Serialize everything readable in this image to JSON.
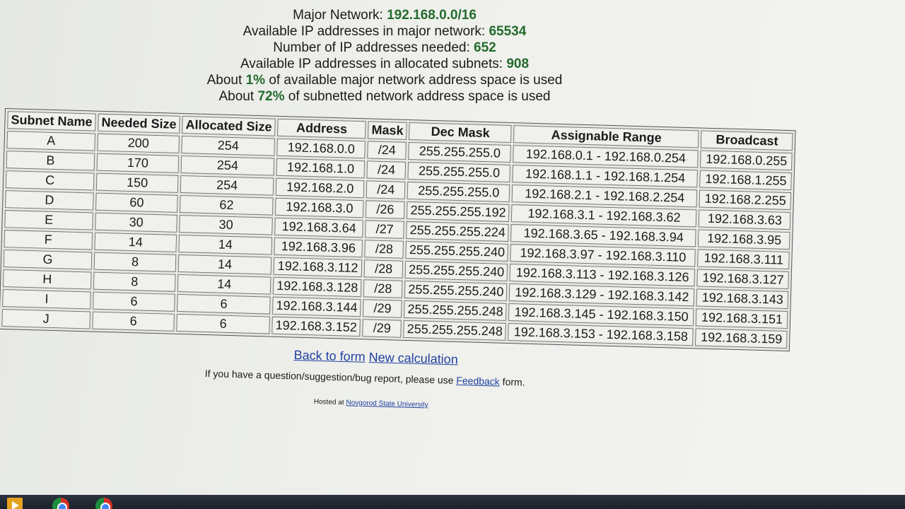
{
  "summary": {
    "major_network_label": "Major Network:",
    "major_network_value": "192.168.0.0/16",
    "available_major_label": "Available IP addresses in major network:",
    "available_major_value": "65534",
    "needed_label": "Number of IP addresses needed:",
    "needed_value": "652",
    "allocated_label": "Available IP addresses in allocated subnets:",
    "allocated_value": "908",
    "major_used_prefix": "About",
    "major_used_value": "1%",
    "major_used_suffix": "of available major network address space is used",
    "subnet_used_prefix": "About",
    "subnet_used_value": "72%",
    "subnet_used_suffix": "of subnetted network address space is used"
  },
  "table": {
    "headers": [
      "Subnet Name",
      "Needed Size",
      "Allocated Size",
      "Address",
      "Mask",
      "Dec Mask",
      "Assignable Range",
      "Broadcast"
    ],
    "rows": [
      [
        "A",
        "200",
        "254",
        "192.168.0.0",
        "/24",
        "255.255.255.0",
        "192.168.0.1 - 192.168.0.254",
        "192.168.0.255"
      ],
      [
        "B",
        "170",
        "254",
        "192.168.1.0",
        "/24",
        "255.255.255.0",
        "192.168.1.1 - 192.168.1.254",
        "192.168.1.255"
      ],
      [
        "C",
        "150",
        "254",
        "192.168.2.0",
        "/24",
        "255.255.255.0",
        "192.168.2.1 - 192.168.2.254",
        "192.168.2.255"
      ],
      [
        "D",
        "60",
        "62",
        "192.168.3.0",
        "/26",
        "255.255.255.192",
        "192.168.3.1 - 192.168.3.62",
        "192.168.3.63"
      ],
      [
        "E",
        "30",
        "30",
        "192.168.3.64",
        "/27",
        "255.255.255.224",
        "192.168.3.65 - 192.168.3.94",
        "192.168.3.95"
      ],
      [
        "F",
        "14",
        "14",
        "192.168.3.96",
        "/28",
        "255.255.255.240",
        "192.168.3.97 - 192.168.3.110",
        "192.168.3.111"
      ],
      [
        "G",
        "8",
        "14",
        "192.168.3.112",
        "/28",
        "255.255.255.240",
        "192.168.3.113 - 192.168.3.126",
        "192.168.3.127"
      ],
      [
        "H",
        "8",
        "14",
        "192.168.3.128",
        "/28",
        "255.255.255.240",
        "192.168.3.129 - 192.168.3.142",
        "192.168.3.143"
      ],
      [
        "I",
        "6",
        "6",
        "192.168.3.144",
        "/29",
        "255.255.255.248",
        "192.168.3.145 - 192.168.3.150",
        "192.168.3.151"
      ],
      [
        "J",
        "6",
        "6",
        "192.168.3.152",
        "/29",
        "255.255.255.248",
        "192.168.3.153 - 192.168.3.158",
        "192.168.3.159"
      ]
    ]
  },
  "links": {
    "back_to_form": "Back to form",
    "new_calculation": "New calculation"
  },
  "feedback": {
    "prefix": "If you have a question/suggestion/bug report, please use",
    "link": "Feedback",
    "suffix": "form."
  },
  "hosted": {
    "prefix": "Hosted at",
    "link": "Novgorod State University"
  },
  "taskbar": {
    "icons": [
      "media-player-icon",
      "chrome-icon",
      "chrome-icon"
    ]
  },
  "colors": {
    "highlight": "#236b2d",
    "link": "#1f3fa0"
  }
}
